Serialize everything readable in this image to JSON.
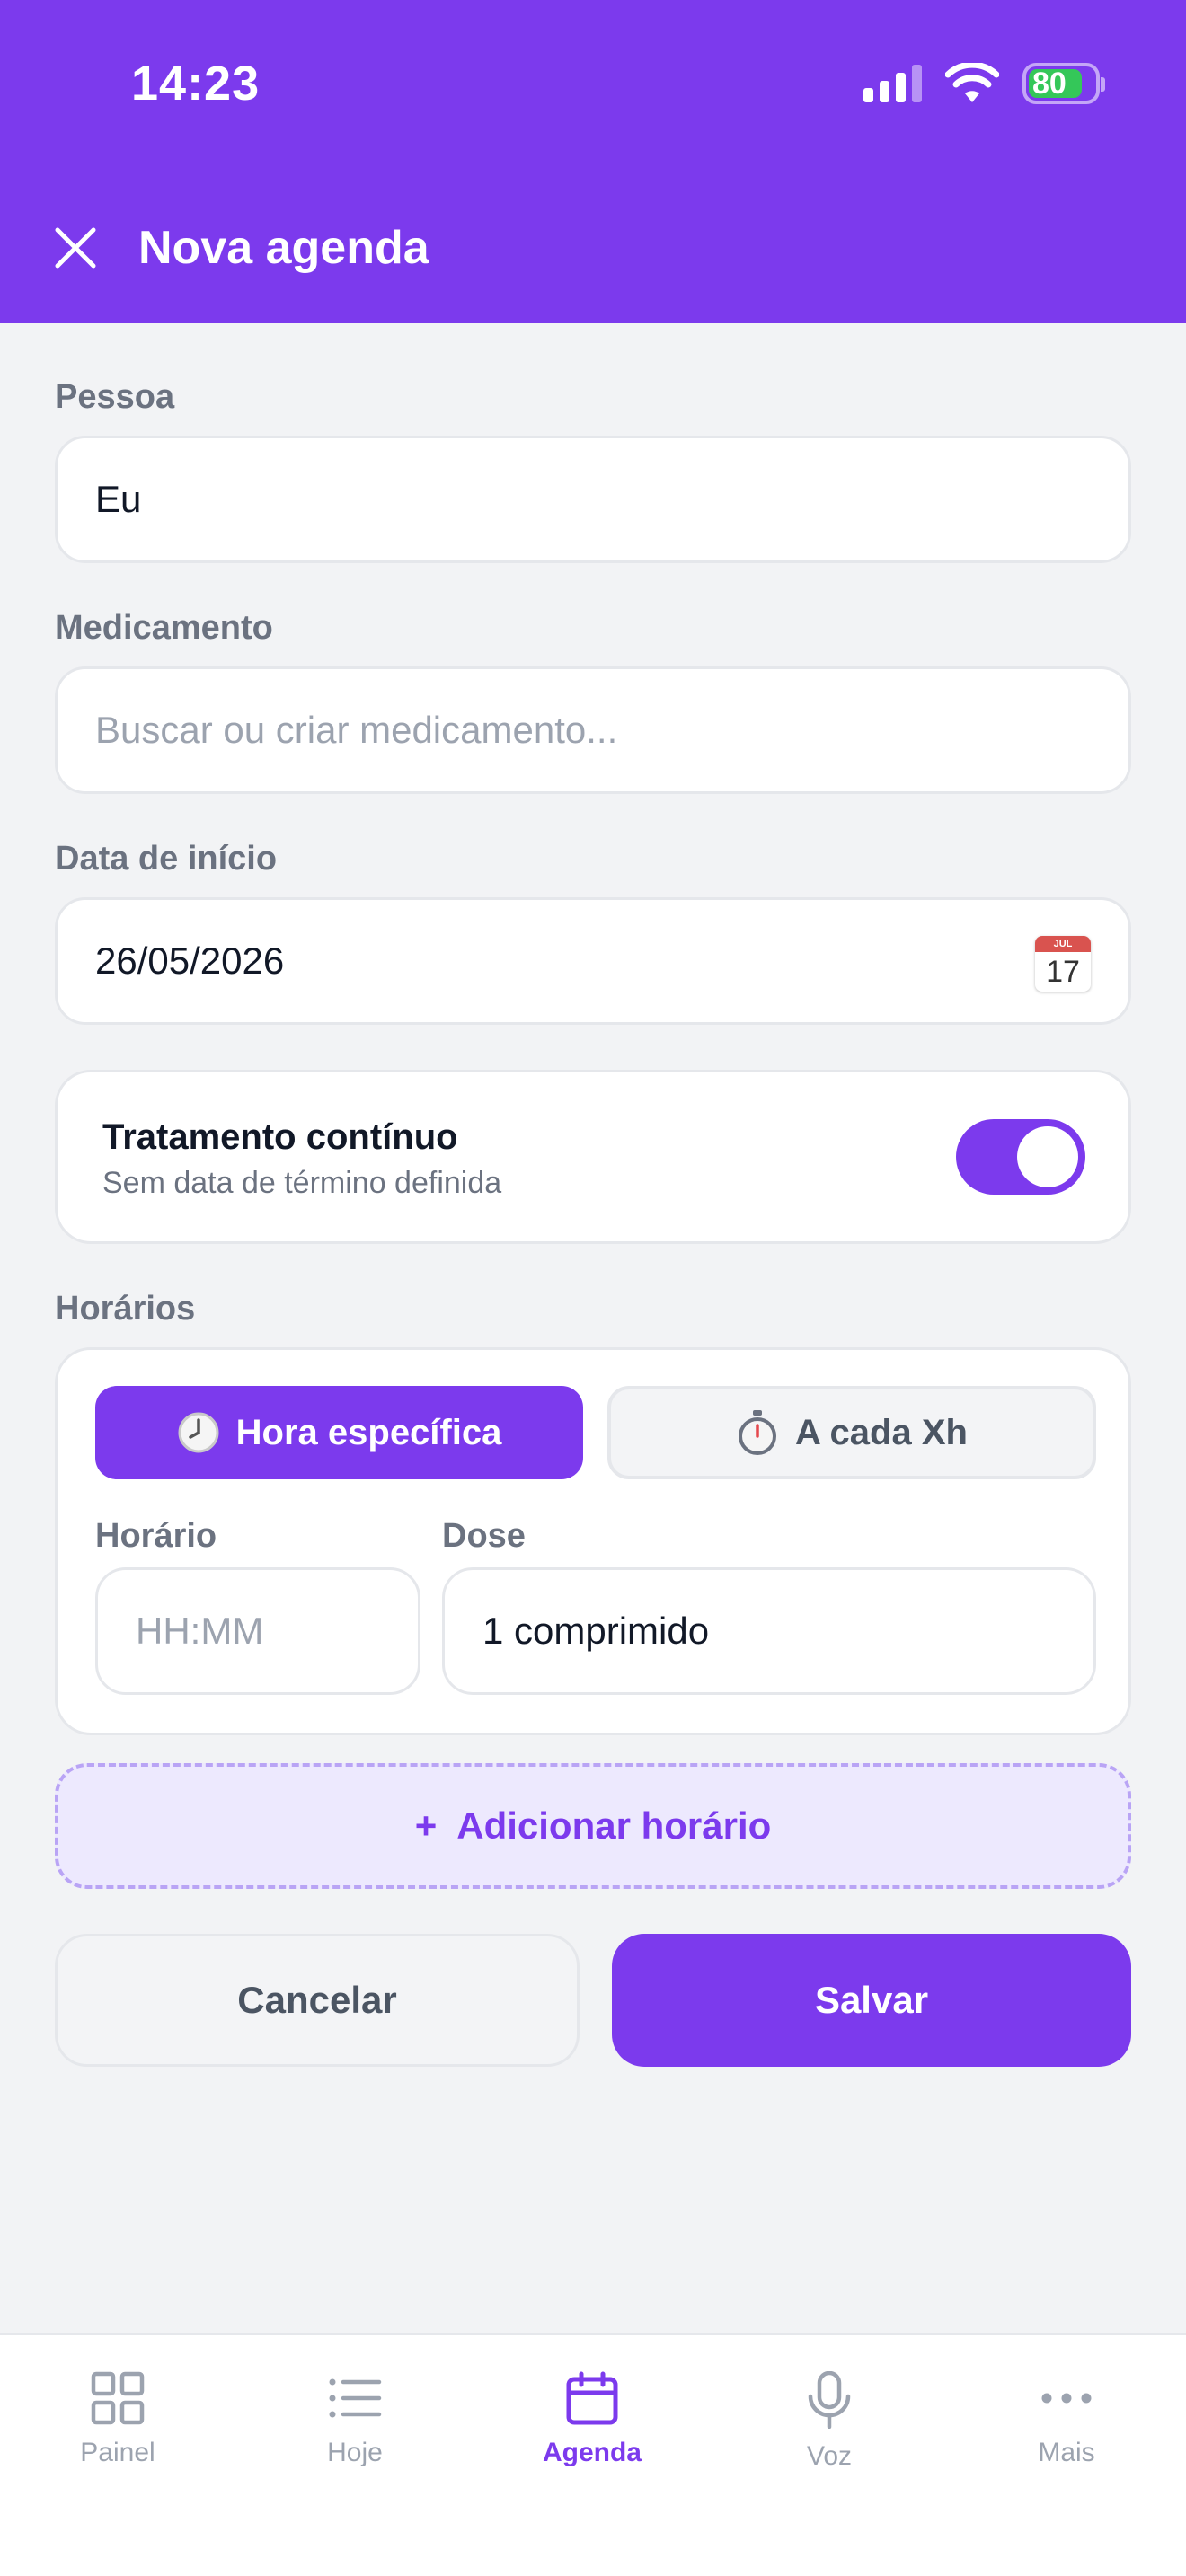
{
  "status_bar": {
    "time": "14:23",
    "battery": "80"
  },
  "header": {
    "title": "Nova agenda",
    "close_icon": "close-icon"
  },
  "form": {
    "person": {
      "label": "Pessoa",
      "value": "Eu"
    },
    "medication": {
      "label": "Medicamento",
      "placeholder": "Buscar ou criar medicamento..."
    },
    "start_date": {
      "label": "Data de início",
      "value": "26/05/2026",
      "icon_month": "JUL",
      "icon_day": "17"
    },
    "continuous": {
      "title": "Tratamento contínuo",
      "subtitle": "Sem data de término definida",
      "enabled": true
    },
    "schedules": {
      "label": "Horários",
      "mode_specific": "Hora específica",
      "mode_interval": "A cada Xh",
      "time_label": "Horário",
      "time_placeholder": "HH:MM",
      "dose_label": "Dose",
      "dose_value": "1 comprimido"
    },
    "add_time": {
      "plus": "+",
      "label": "Adicionar horário"
    },
    "cancel_label": "Cancelar",
    "save_label": "Salvar"
  },
  "tabbar": {
    "items": [
      {
        "label": "Painel",
        "icon": "grid-icon"
      },
      {
        "label": "Hoje",
        "icon": "list-icon"
      },
      {
        "label": "Agenda",
        "icon": "calendar-icon",
        "active": true
      },
      {
        "label": "Voz",
        "icon": "microphone-icon"
      },
      {
        "label": "Mais",
        "icon": "more-icon"
      }
    ]
  },
  "colors": {
    "primary": "#7c3aed",
    "primary_light": "#ede9fe",
    "background": "#f2f3f5",
    "muted_text": "#6b7280"
  }
}
